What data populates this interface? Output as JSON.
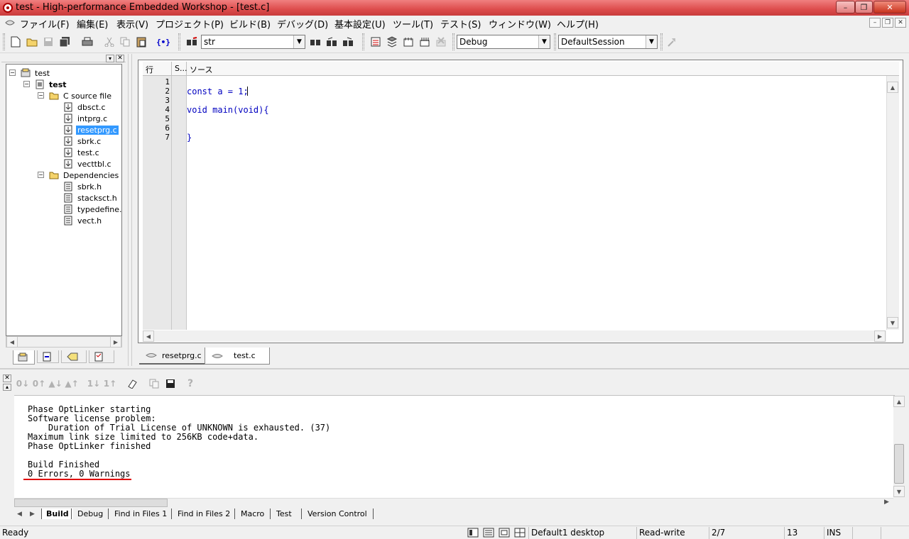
{
  "window": {
    "title": "test - High-performance Embedded Workshop - [test.c]",
    "min": "–",
    "max": "❐",
    "close": "✕"
  },
  "menu": {
    "items": [
      "ファイル(F)",
      "編集(E)",
      "表示(V)",
      "プロジェクト(P)",
      "ビルド(B)",
      "デバッグ(D)",
      "基本設定(U)",
      "ツール(T)",
      "テスト(S)",
      "ウィンドウ(W)",
      "ヘルプ(H)"
    ],
    "mdi_min": "–",
    "mdi_restore": "❐",
    "mdi_close": "✕"
  },
  "toolbar": {
    "search_value": "str",
    "config_value": "Debug",
    "session_value": "DefaultSession"
  },
  "workspace": {
    "tree": {
      "root": "test",
      "project": "test",
      "folder_c": "C source file",
      "c_files": [
        "dbsct.c",
        "intprg.c",
        "resetprg.c",
        "sbrk.c",
        "test.c",
        "vecttbl.c"
      ],
      "folder_deps": "Dependencies",
      "dep_files": [
        "sbrk.h",
        "stacksct.h",
        "typedefine.h",
        "vect.h"
      ],
      "selected": "resetprg.c"
    }
  },
  "editor": {
    "col_line": "行番...",
    "col_s": "S...",
    "col_source": "ソース",
    "line_numbers": [
      "1",
      "2",
      "3",
      "4",
      "5",
      "6",
      "7"
    ],
    "lines": [
      "",
      "const a = 1;",
      "",
      "void main(void){",
      "",
      "",
      "}"
    ],
    "tabs": [
      "resetprg.c",
      "test.c"
    ],
    "active_tab": "test.c"
  },
  "output": {
    "lines": [
      "Phase OptLinker starting",
      "Software license problem:",
      "    Duration of Trial License of UNKNOWN is exhausted. (37)",
      "Maximum link size limited to 256KB code+data.",
      "Phase OptLinker finished",
      "",
      "Build Finished",
      "0 Errors, 0 Warnings"
    ],
    "tabs": [
      "Build",
      "Debug",
      "Find in Files 1",
      "Find in Files 2",
      "Macro",
      "Test",
      "Version Control"
    ],
    "active_tab": "Build",
    "highlight_color": "#e00000"
  },
  "status": {
    "ready": "Ready",
    "desktop": "Default1 desktop",
    "mode": "Read-write",
    "position": "2/7",
    "column": "13",
    "ins": "INS"
  },
  "colors": {
    "title_bar": "#dd4c4c",
    "selection": "#3399ff",
    "code_keyword": "#0000c0"
  }
}
